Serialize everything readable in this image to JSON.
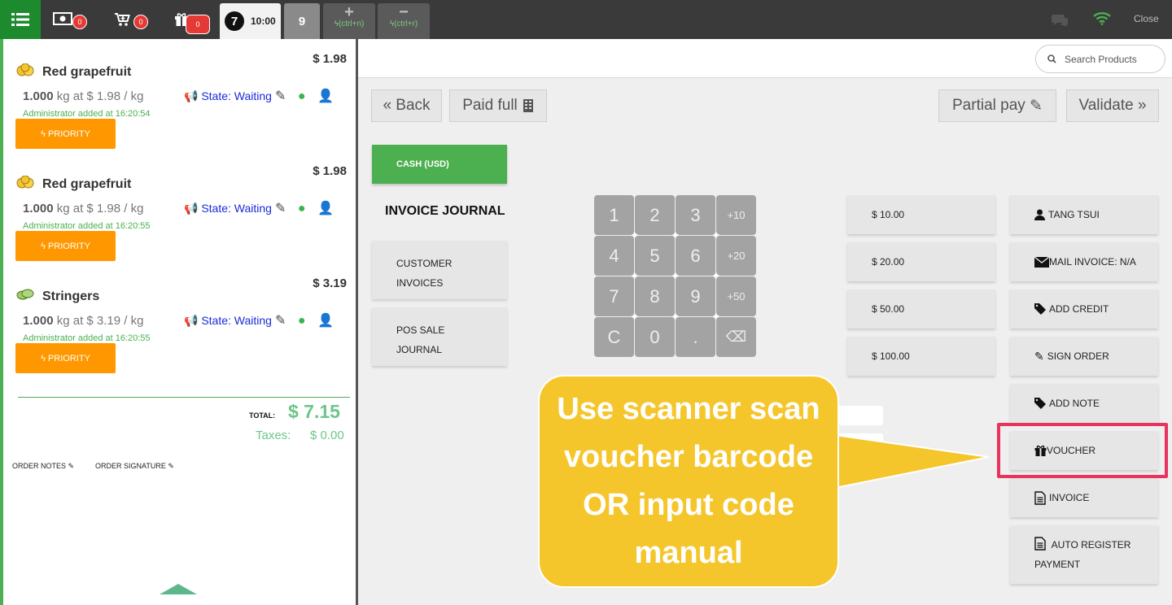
{
  "topbar": {
    "cash_badge": "0",
    "cart_badge": "0",
    "gift_badge": "0",
    "order_number": "7",
    "order_time": "10:00",
    "order_tab_2": "9",
    "new_order_hint": "(ctrl+n)",
    "remove_order_hint": "(ctrl+r)",
    "close_label": "Close"
  },
  "order": {
    "lines": [
      {
        "name": "Red grapefruit",
        "price": "$ 1.98",
        "qty": "1.000",
        "unit_text": "kg at $ 1.98 / kg",
        "state": "State: Waiting",
        "added": "Administrator added at 16:20:54",
        "priority": "PRIORITY"
      },
      {
        "name": "Red grapefruit",
        "price": "$ 1.98",
        "qty": "1.000",
        "unit_text": "kg at $ 1.98 / kg",
        "state": "State: Waiting",
        "added": "Administrator added at 16:20:55",
        "priority": "PRIORITY"
      },
      {
        "name": "Stringers",
        "price": "$ 3.19",
        "qty": "1.000",
        "unit_text": "kg at $ 3.19 / kg",
        "state": "State: Waiting",
        "added": "Administrator added at 16:20:55",
        "priority": "PRIORITY"
      }
    ],
    "total_label": "TOTAL:",
    "total_value": "$ 7.15",
    "taxes_label": "Taxes:",
    "taxes_value": "$ 0.00",
    "order_notes": "ORDER NOTES",
    "order_signature": "ORDER SIGNATURE"
  },
  "search": {
    "placeholder": "Search Products"
  },
  "payment": {
    "back": "Back",
    "paid_full": "Paid full",
    "partial_pay": "Partial pay",
    "validate": "Validate",
    "cash": "CASH (USD)",
    "invoice_journal": "INVOICE JOURNAL",
    "customer_invoices_1": "CUSTOMER",
    "customer_invoices_2": "INVOICES",
    "pos_sale_1": "POS SALE",
    "pos_sale_2": "JOURNAL"
  },
  "numpad": [
    "1",
    "2",
    "3",
    "+10",
    "4",
    "5",
    "6",
    "+20",
    "7",
    "8",
    "9",
    "+50",
    "C",
    "0",
    ".",
    "⌫"
  ],
  "amounts": [
    "$ 10.00",
    "$ 20.00",
    "$ 50.00",
    "$ 100.00"
  ],
  "actions": {
    "customer": "TANG TSUI",
    "mail_invoice": "MAIL INVOICE: N/A",
    "add_credit": "ADD CREDIT",
    "sign_order": "SIGN ORDER",
    "add_note": "ADD NOTE",
    "voucher": "VOUCHER",
    "invoice": "INVOICE",
    "auto_register_1": "AUTO REGISTER",
    "auto_register_2": "PAYMENT"
  },
  "callout": {
    "line1": "Use scanner scan",
    "line2": "voucher barcode",
    "line3": "OR input code",
    "line4": "manual"
  },
  "colors": {
    "accent_green": "#4caf50",
    "priority_orange": "#ff9800",
    "highlight_pink": "#e8335f",
    "callout_yellow": "#f5c62c",
    "badge_red": "#e53935"
  }
}
